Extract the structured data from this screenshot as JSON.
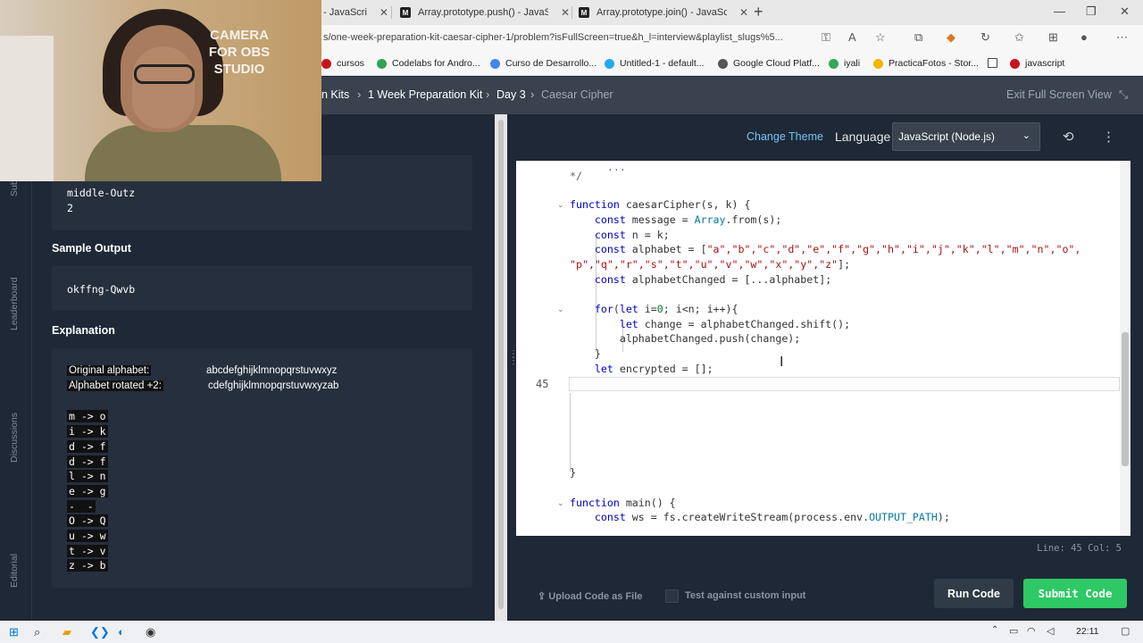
{
  "browser": {
    "tabs": [
      {
        "title": "Array.prototype.push() - JavaScript",
        "favicon": "M"
      },
      {
        "title": "Array.prototype.join() - JavaScript",
        "favicon": "M"
      }
    ],
    "partial_tab": "- JavaScri",
    "url": "s/one-week-preparation-kit-caesar-cipher-1/problem?isFullScreen=true&h_l=interview&playlist_slugs%5...",
    "bookmarks": [
      "cursos",
      "Codelabs for Andro...",
      "Curso de Desarrollo...",
      "Untitled-1 - default...",
      "Google Cloud Platf...",
      "iyali",
      "PracticaFotos - Stor...",
      "javascript"
    ]
  },
  "breadcrumb": {
    "items": [
      "n Kits",
      "1 Week Preparation Kit",
      "Day 3",
      "Caesar Cipher"
    ],
    "separator": "›",
    "exit": "Exit Full Screen View"
  },
  "rail": [
    "Sub",
    "Leaderboard",
    "Discussions",
    "Editorial"
  ],
  "problem": {
    "sample_input_lines": [
      "middle-Outz",
      "2"
    ],
    "sample_output_title": "Sample Output",
    "sample_output": "okffng-Qwvb",
    "explanation_title": "Explanation",
    "original_label": "Original alphabet:",
    "original_value": "abcdefghijklmnopqrstuvwxyz",
    "rotated_label": "Alphabet rotated +2:",
    "rotated_value": "cdefghijklmnopqrstuvwxyzab",
    "mappings": [
      "m -> o",
      "i -> k",
      "d -> f",
      "d -> f",
      "l -> n",
      "e -> g",
      "-  -",
      "O -> Q",
      "u -> w",
      "t -> v",
      "z -> b"
    ]
  },
  "editor": {
    "change_theme": "Change Theme",
    "language_label": "Language",
    "language": "JavaScript (Node.js)",
    "current_line_number": "45",
    "status": "Line: 45 Col: 5",
    "code": {
      "l0": "*/",
      "l1a": "function",
      "l1b": " caesarCipher(s, k) {",
      "l2a": "    const",
      "l2b": " message = ",
      "l2c": "Array",
      "l2d": ".from(s);",
      "l3a": "    const",
      "l3b": " n = k;",
      "l4a": "    const",
      "l4b": " alphabet = [",
      "l4c": "\"a\",\"b\",\"c\",\"d\",\"e\",\"f\",\"g\",\"h\",\"i\",\"j\",\"k\",\"l\",\"m\",\"n\",\"o\",",
      "l5a": "\"p\",\"q\",\"r\",\"s\",\"t\",\"u\",\"v\",\"w\",\"x\",\"y\",\"z\"",
      "l5b": "];",
      "l6a": "    const",
      "l6b": " alphabetChanged = [...alphabet];",
      "l7a": "    for",
      "l7b": "(",
      "l7c": "let",
      "l7d": " i=",
      "l7e": "0",
      "l7f": "; i<n; i++){",
      "l8a": "        let",
      "l8b": " change = alphabetChanged.shift();",
      "l9": "        alphabetChanged.push(change);",
      "l10": "    }",
      "l11a": "    let",
      "l11b": " encrypted = [];",
      "l12": "}",
      "l13a": "function",
      "l13b": " main() {",
      "l14a": "    const",
      "l14b": " ws = fs.createWriteStream(process.env.",
      "l14c": "OUTPUT_PATH",
      "l14d": ");"
    },
    "upload": "Upload Code as File",
    "custom_input": "Test against custom input",
    "run": "Run Code",
    "submit": "Submit Code"
  },
  "camera_text": "CAMERA FOR OBS STUDIO",
  "taskbar": {
    "time": "22:11"
  }
}
